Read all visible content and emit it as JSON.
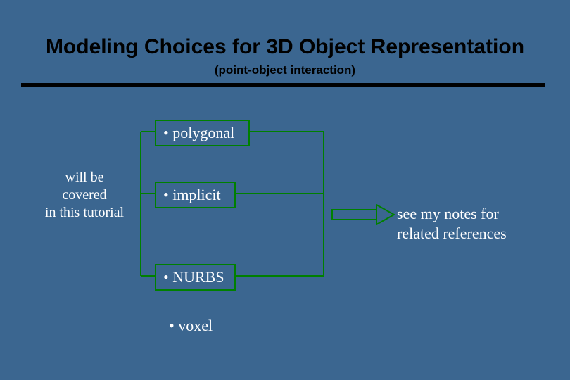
{
  "header": {
    "title": "Modeling Choices for 3D Object Representation",
    "subtitle": "(point-object interaction)"
  },
  "items": {
    "polygonal": "• polygonal",
    "implicit": "• implicit",
    "nurbs": "• NURBS",
    "voxel": "• voxel"
  },
  "notes": {
    "left_l1": "will be",
    "left_l2": "covered",
    "left_l3": "in this tutorial",
    "right_l1": "see my notes for",
    "right_l2": "related references"
  },
  "colors": {
    "bg": "#3b6690",
    "box_border": "#008000",
    "text_light": "#ffffff",
    "text_dark": "#000000"
  }
}
